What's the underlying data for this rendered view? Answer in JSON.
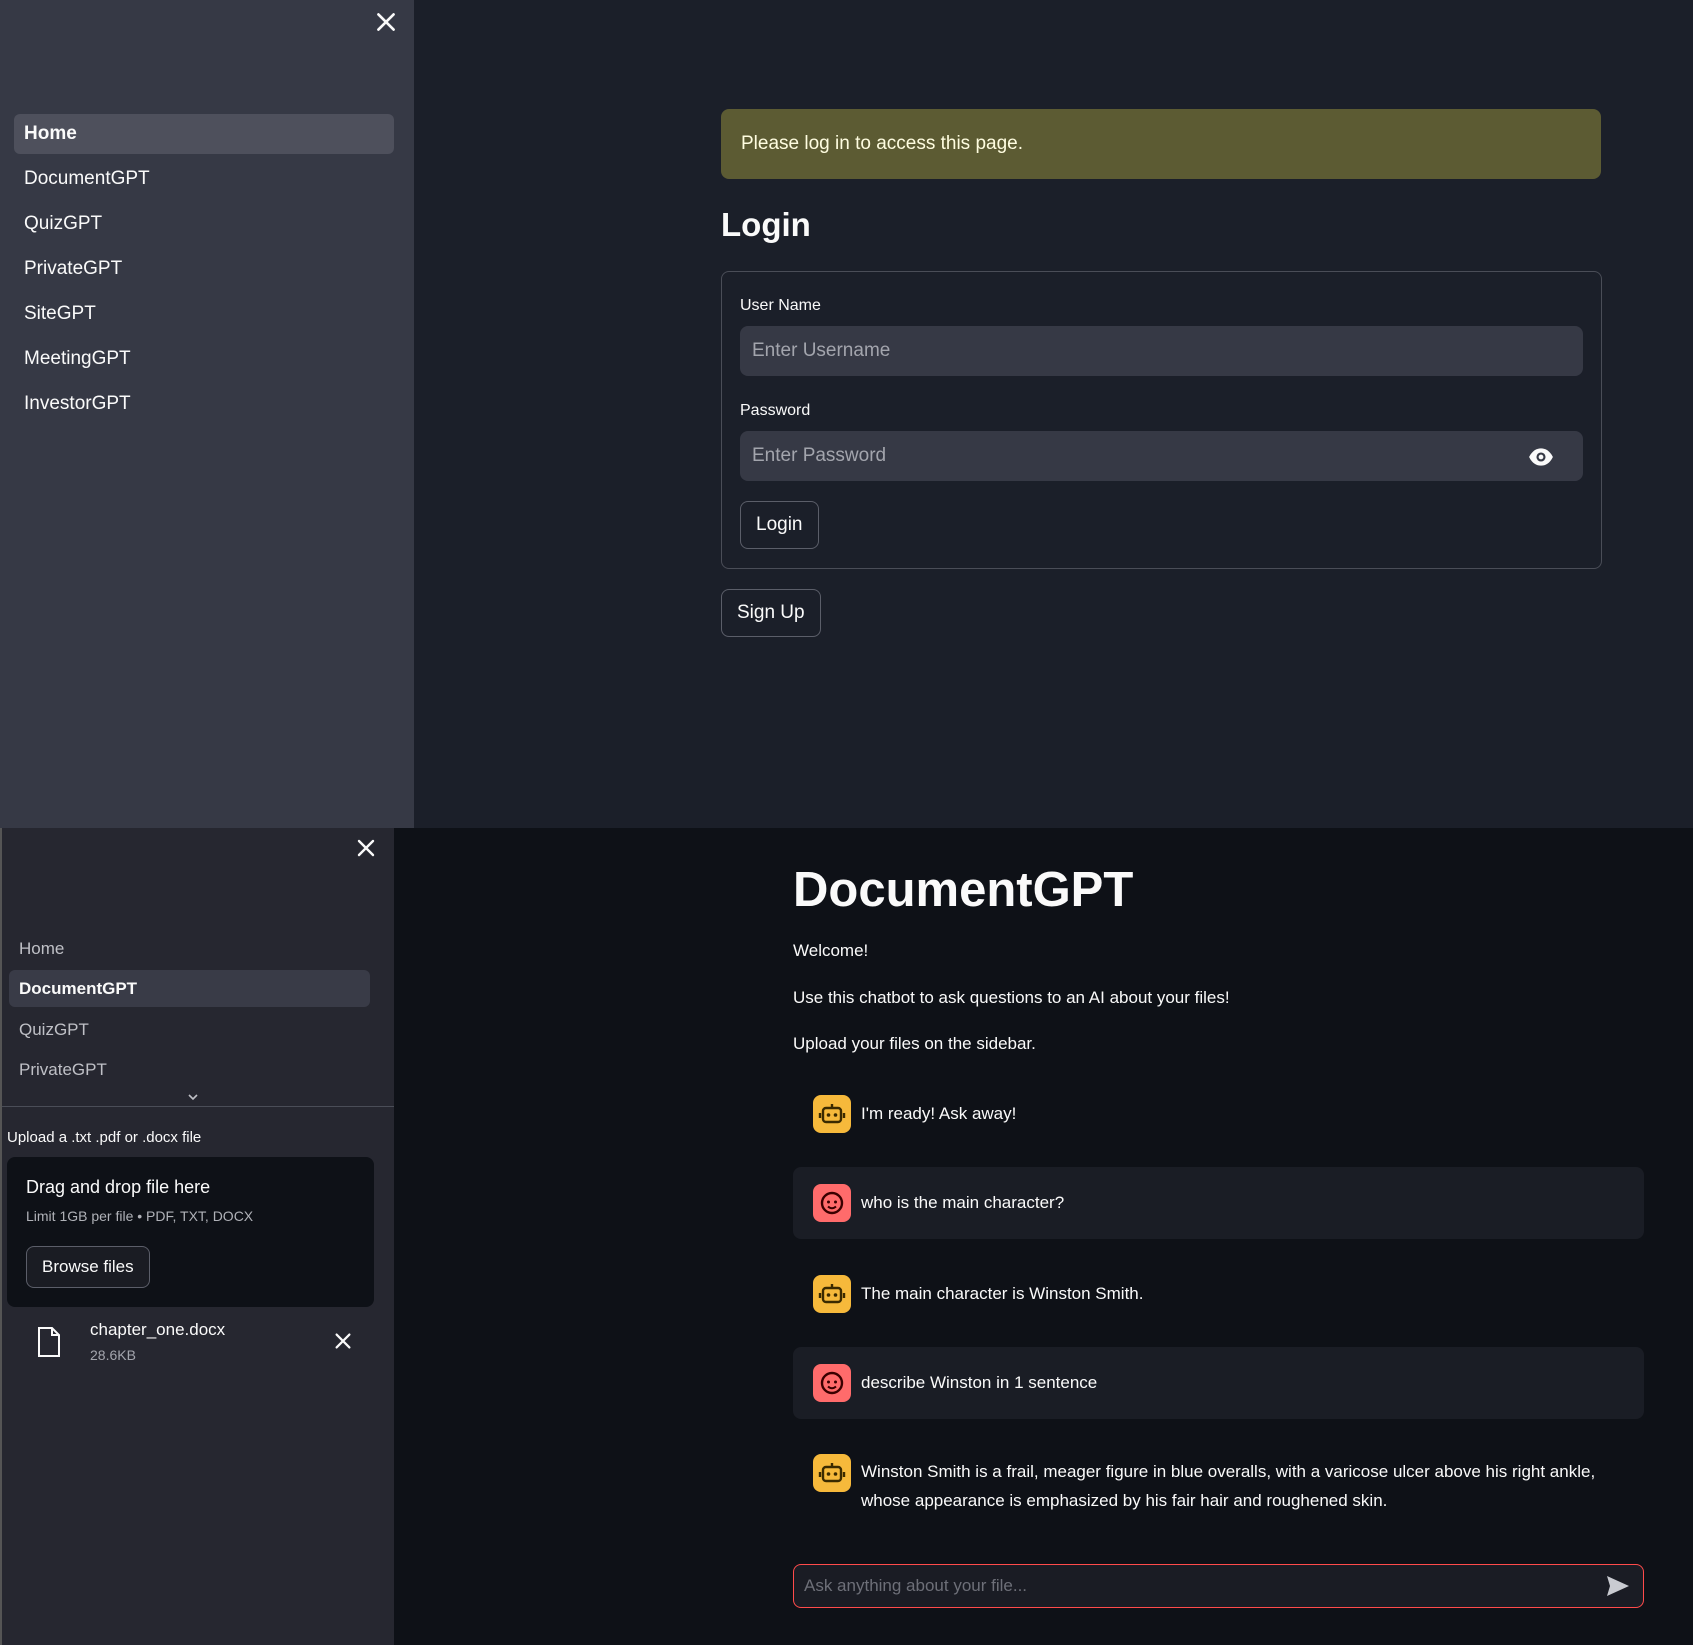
{
  "login_screen": {
    "sidebar": {
      "items": [
        {
          "label": "Home",
          "active": true
        },
        {
          "label": "DocumentGPT"
        },
        {
          "label": "QuizGPT"
        },
        {
          "label": "PrivateGPT"
        },
        {
          "label": "SiteGPT"
        },
        {
          "label": "MeetingGPT"
        },
        {
          "label": "InvestorGPT"
        }
      ]
    },
    "alert": "Please log in to access this page.",
    "heading": "Login",
    "username_label": "User Name",
    "username_placeholder": "Enter Username",
    "password_label": "Password",
    "password_placeholder": "Enter Password",
    "login_button": "Login",
    "signup_button": "Sign Up"
  },
  "document_screen": {
    "sidebar": {
      "items": [
        {
          "label": "Home"
        },
        {
          "label": "DocumentGPT",
          "active": true
        },
        {
          "label": "QuizGPT"
        },
        {
          "label": "PrivateGPT"
        }
      ],
      "upload_label": "Upload a .txt .pdf or .docx file",
      "dropzone_title": "Drag and drop file here",
      "dropzone_limit": "Limit 1GB per file • PDF, TXT, DOCX",
      "browse_button": "Browse files",
      "file_name": "chapter_one.docx",
      "file_size": "28.6KB"
    },
    "title": "DocumentGPT",
    "welcome": "Welcome!",
    "intro": "Use this chatbot to ask questions to an AI about your files!",
    "upload_hint": "Upload your files on the sidebar.",
    "messages": [
      {
        "role": "ai",
        "text": "I'm ready! Ask away!"
      },
      {
        "role": "human",
        "text": "who is the main character?"
      },
      {
        "role": "ai",
        "text": "The main character is Winston Smith."
      },
      {
        "role": "human",
        "text": "describe Winston in 1 sentence"
      },
      {
        "role": "ai",
        "text": "Winston Smith is a frail, meager figure in blue overalls, with a varicose ulcer above his right ankle, whose appearance is emphasized by his fair hair and roughened skin."
      }
    ],
    "chat_placeholder": "Ask anything about your file..."
  },
  "colors": {
    "alert_bg": "#5c5b33",
    "ai_avatar": "#f6b93b",
    "human_avatar": "#ff6b6b",
    "chat_border": "#ff4b4b"
  },
  "icons": [
    "close-icon",
    "eye-icon",
    "chevron-down-icon",
    "file-icon",
    "robot-icon",
    "face-icon",
    "send-icon"
  ]
}
